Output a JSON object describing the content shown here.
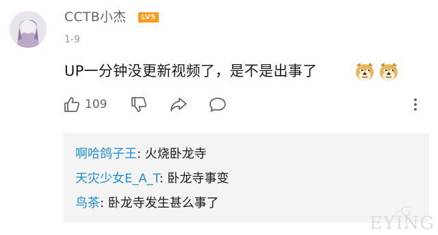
{
  "comment": {
    "username": "CCTB小杰",
    "level_badge": "LV5",
    "date": "1-9",
    "text": "UP一分钟没更新视频了，是不是出事了",
    "emotes": [
      "doge-emote",
      "doge-emote"
    ]
  },
  "actions": {
    "like_count": "109",
    "icons": [
      "thumbs-up-icon",
      "thumbs-down-icon",
      "share-icon",
      "comment-icon",
      "more-vertical-icon"
    ]
  },
  "replies": [
    {
      "user": "啊哈鸽子王",
      "separator": ": ",
      "text": "火烧卧龙寺"
    },
    {
      "user": "天灾少女E_A_T",
      "separator": ": ",
      "text": "卧龙寺事变"
    },
    {
      "user": "鸟茶",
      "separator": ": ",
      "text": "卧龙寺发生甚么事了"
    }
  ],
  "watermark": {
    "text": "EYING"
  },
  "colors": {
    "username": "#61666d",
    "badge": "#ff9a1a",
    "reply_user": "#1f8fd3",
    "reply_bg": "#f4f4f4"
  }
}
